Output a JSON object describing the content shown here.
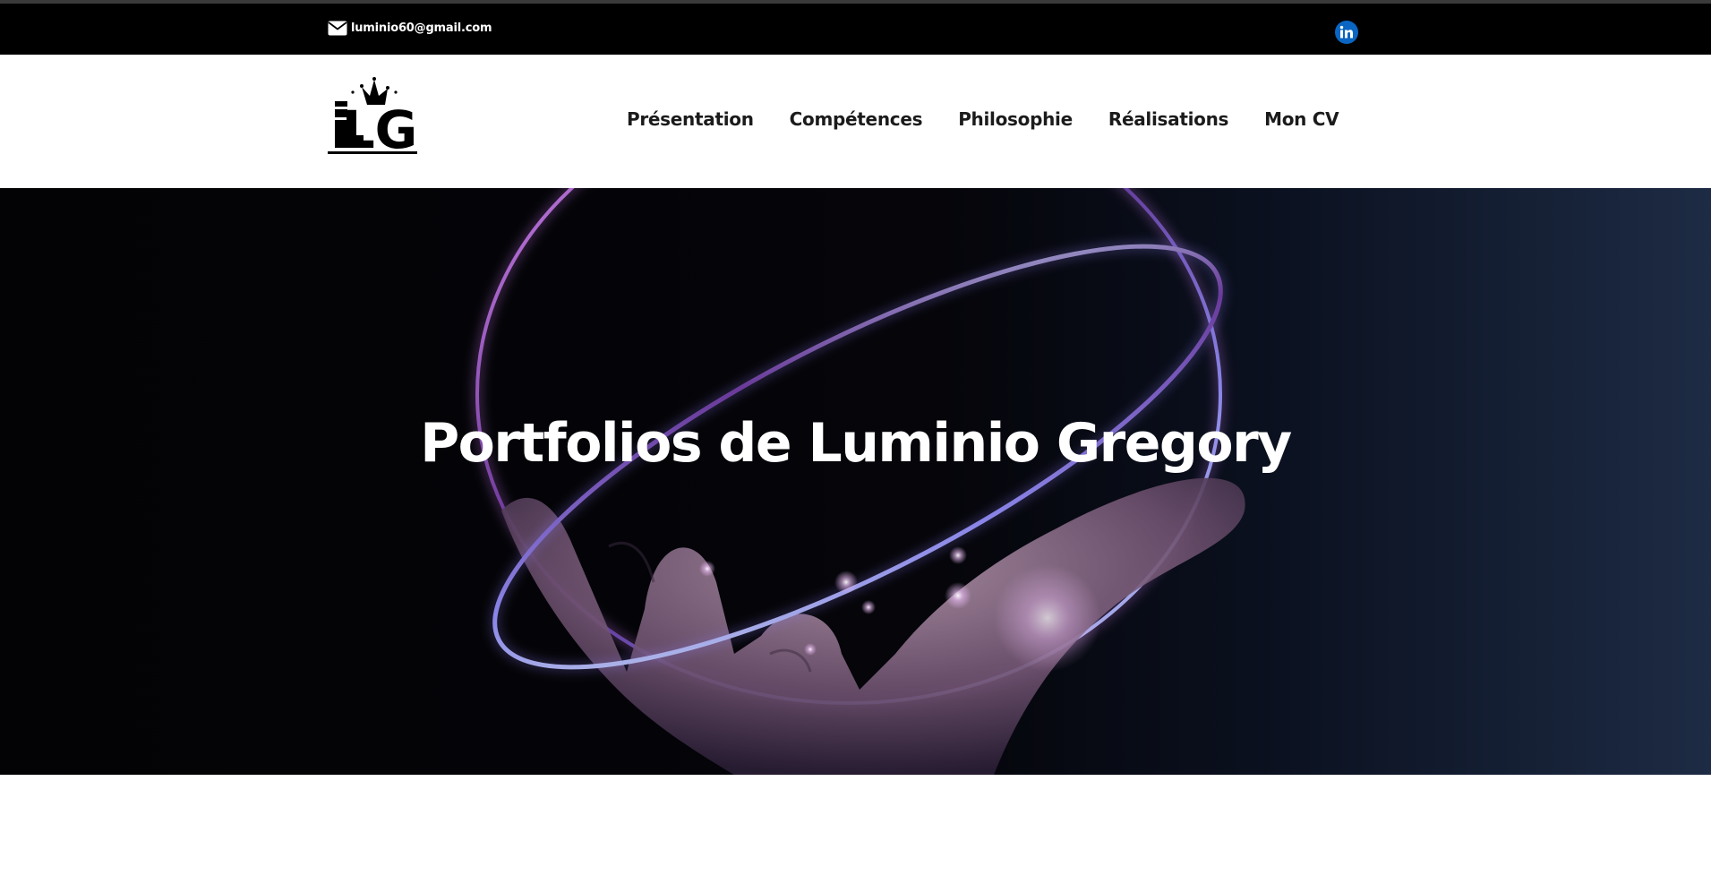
{
  "topbar": {
    "email": "luminio60@gmail.com",
    "email_icon": "envelope-icon",
    "social_icon": "linkedin-icon",
    "linkedin_color": "#0a66c2"
  },
  "header": {
    "logo_text": "LG",
    "nav": [
      {
        "label": "Présentation"
      },
      {
        "label": "Compétences"
      },
      {
        "label": "Philosophie"
      },
      {
        "label": "Réalisations"
      },
      {
        "label": "Mon CV"
      }
    ]
  },
  "hero": {
    "title": "Portfolios de Luminio Gregory"
  },
  "colors": {
    "topbar_bg": "#000000",
    "header_bg": "#ffffff",
    "nav_text": "#1b1b1b",
    "hero_text": "#ffffff",
    "ring_purple": "#c27be8",
    "ring_blue": "#7f7be0"
  }
}
